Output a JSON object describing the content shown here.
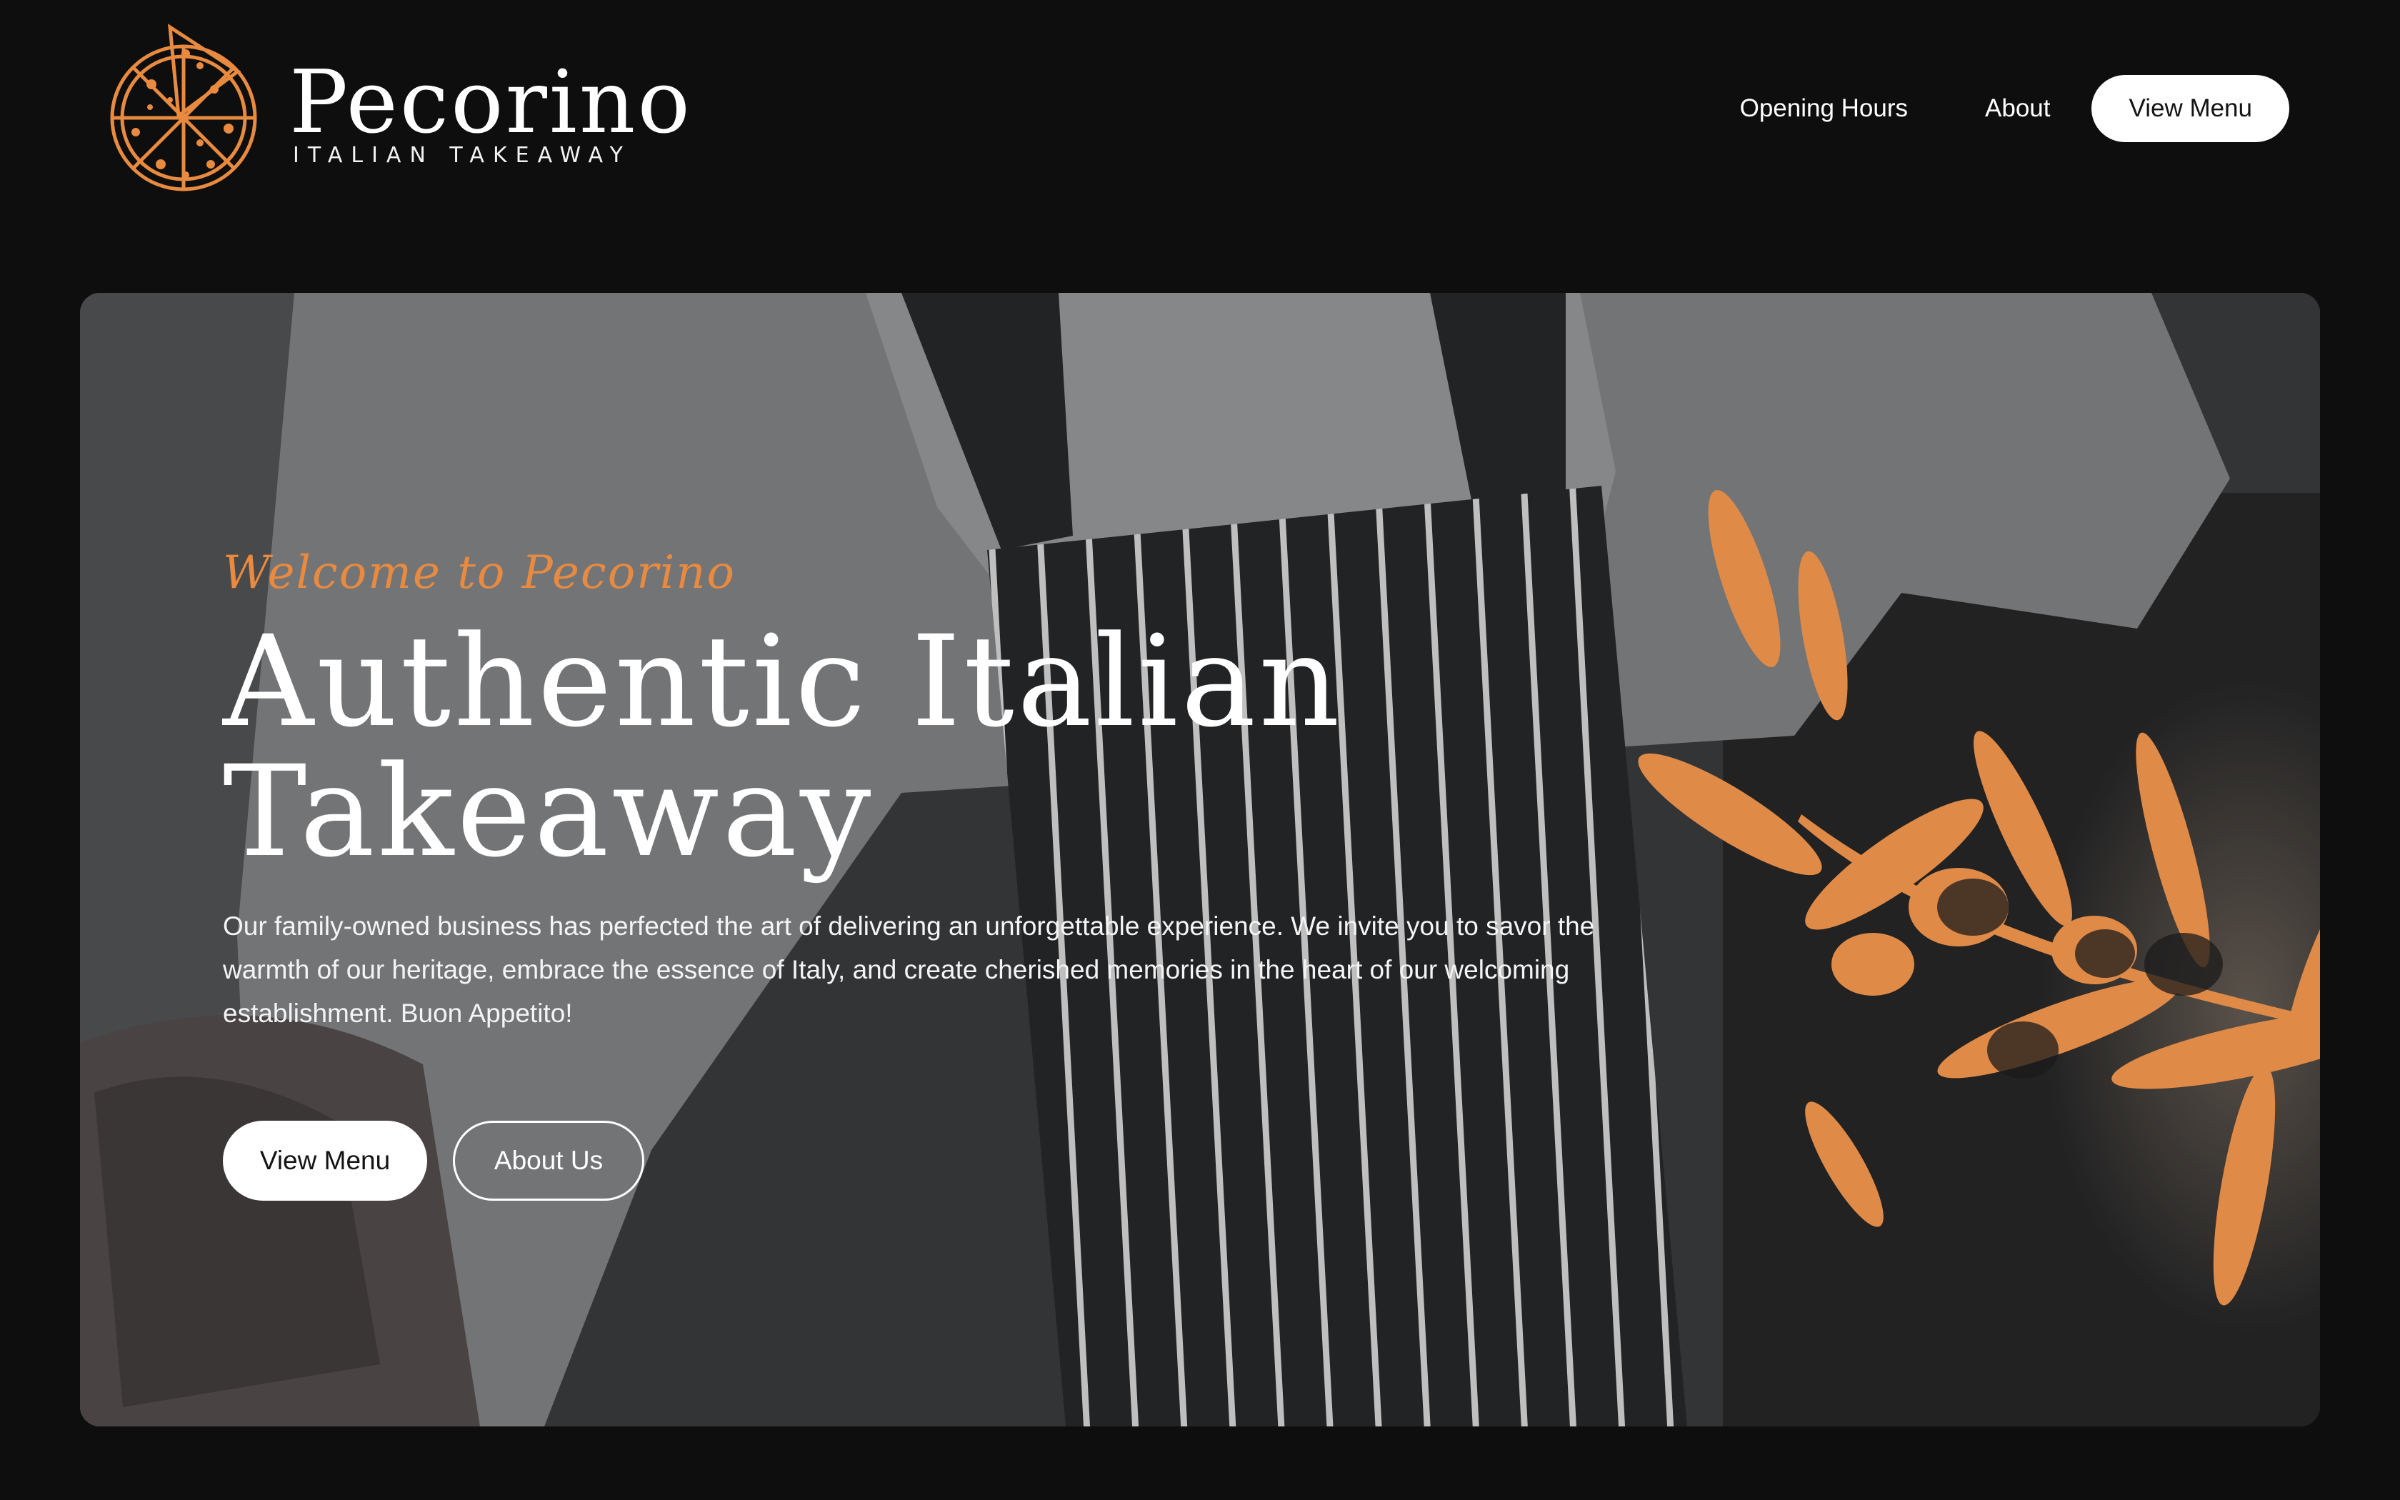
{
  "brand": {
    "name": "Pecorino",
    "tagline": "ITALIAN TAKEAWAY",
    "logo_icon": "pizza-icon",
    "accent_color": "#e88a3f"
  },
  "nav": {
    "opening_hours": "Opening Hours",
    "about": "About",
    "view_menu": "View Menu"
  },
  "hero": {
    "eyebrow": "Welcome to Pecorino",
    "headline": "Authentic Italian Takeaway",
    "body": "Our family-owned business has perfected the art of delivering an unforgettable experience. We invite you to savor the warmth of our heritage, embrace the essence of Italy, and create cherished memories in the heart of our welcoming establishment. Buon Appetito!",
    "primary_cta": "View Menu",
    "secondary_cta": "About Us",
    "background_image": "chef-in-striped-apron-photo",
    "decoration": "olive-branch-illustration"
  },
  "colors": {
    "page_background": "#0e0e0f",
    "text": "#ffffff",
    "accent": "#e88a3f"
  }
}
